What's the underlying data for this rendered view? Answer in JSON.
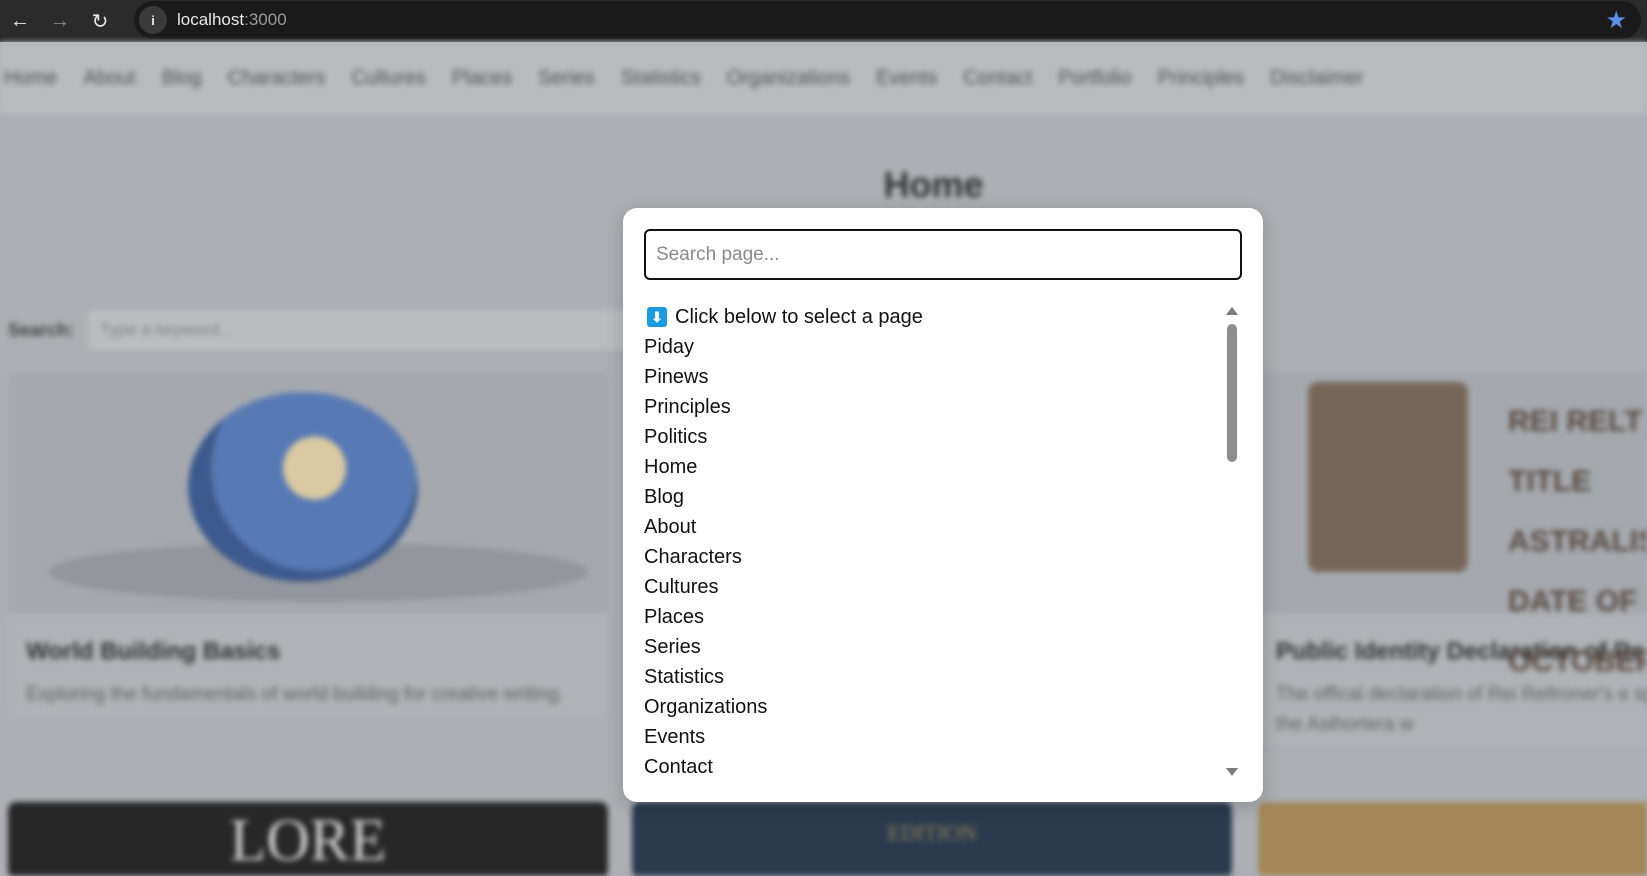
{
  "browser": {
    "url_host": "localhost",
    "url_port": ":3000",
    "icons": {
      "back": "back-arrow-icon",
      "forward": "forward-arrow-icon",
      "reload": "reload-icon",
      "site_info": "info-icon",
      "bookmark": "star-icon"
    },
    "colors": {
      "bookmark_star": "#5b8def"
    }
  },
  "background_page": {
    "nav": [
      "Home",
      "About",
      "Blog",
      "Characters",
      "Cultures",
      "Places",
      "Series",
      "Statistics",
      "Organizations",
      "Events",
      "Contact",
      "Portfolio",
      "Principles",
      "Disclaimer"
    ],
    "title": "Home",
    "search_label": "Search:",
    "search_placeholder": "Type a keyword...",
    "cards": [
      {
        "title": "World Building Basics",
        "description": "Exploring the fundamentals of world building for creative writing."
      },
      {
        "title": "Public Identity Declaration of Re",
        "description": "The offical declaration of Rei Reltroner's e spiritual alignment with the Asthortera w"
      }
    ],
    "poster_text": "REI RELT\nTITLE\nASTRALIS A\nDATE OF BIR\nOCTOBER",
    "bottom_cards": [
      "LORE",
      "EDITION"
    ]
  },
  "modal": {
    "search_placeholder": "Search page...",
    "search_value": "",
    "hint_icon": "down-arrow-icon",
    "hint": "Click below to select a page",
    "items": [
      "Piday",
      "Pinews",
      "Principles",
      "Politics",
      "Home",
      "Blog",
      "About",
      "Characters",
      "Cultures",
      "Places",
      "Series",
      "Statistics",
      "Organizations",
      "Events",
      "Contact"
    ],
    "colors": {
      "hint_icon_bg": "#1a9ae0"
    }
  }
}
